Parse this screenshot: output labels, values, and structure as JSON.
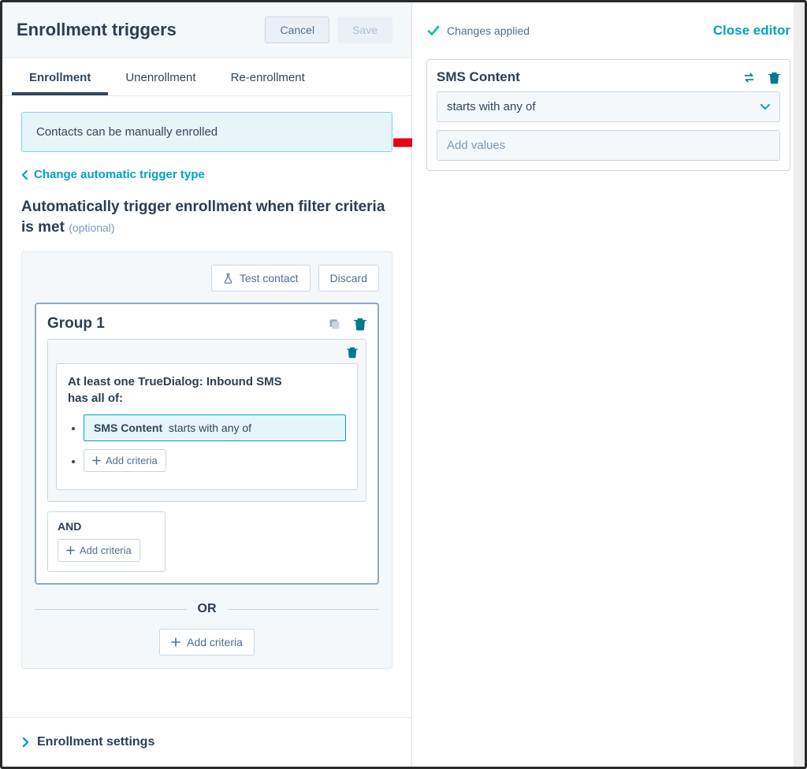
{
  "header": {
    "title": "Enrollment triggers",
    "cancel": "Cancel",
    "save": "Save"
  },
  "tabs": {
    "items": [
      "Enrollment",
      "Unenrollment",
      "Re-enrollment"
    ],
    "active": 0
  },
  "banner": "Contacts can be manually enrolled",
  "change_trigger_link": "Change automatic trigger type",
  "section": {
    "title": "Automatically trigger enrollment when filter criteria is met",
    "optional": "(optional)"
  },
  "card_actions": {
    "test_contact": "Test contact",
    "discard": "Discard"
  },
  "group": {
    "title": "Group 1",
    "criteria_text_part1": "At least one TrueDialog: Inbound SMS",
    "criteria_text_part2": "has all of:",
    "chip_property": "SMS Content",
    "chip_operator": "starts with any of",
    "add_criteria": "Add criteria",
    "and_label": "AND",
    "or_label": "OR"
  },
  "footer": {
    "label": "Enrollment settings"
  },
  "right": {
    "status": "Changes applied",
    "close": "Close editor",
    "property": "SMS Content",
    "operator": "starts with any of",
    "add_values_placeholder": "Add values"
  }
}
